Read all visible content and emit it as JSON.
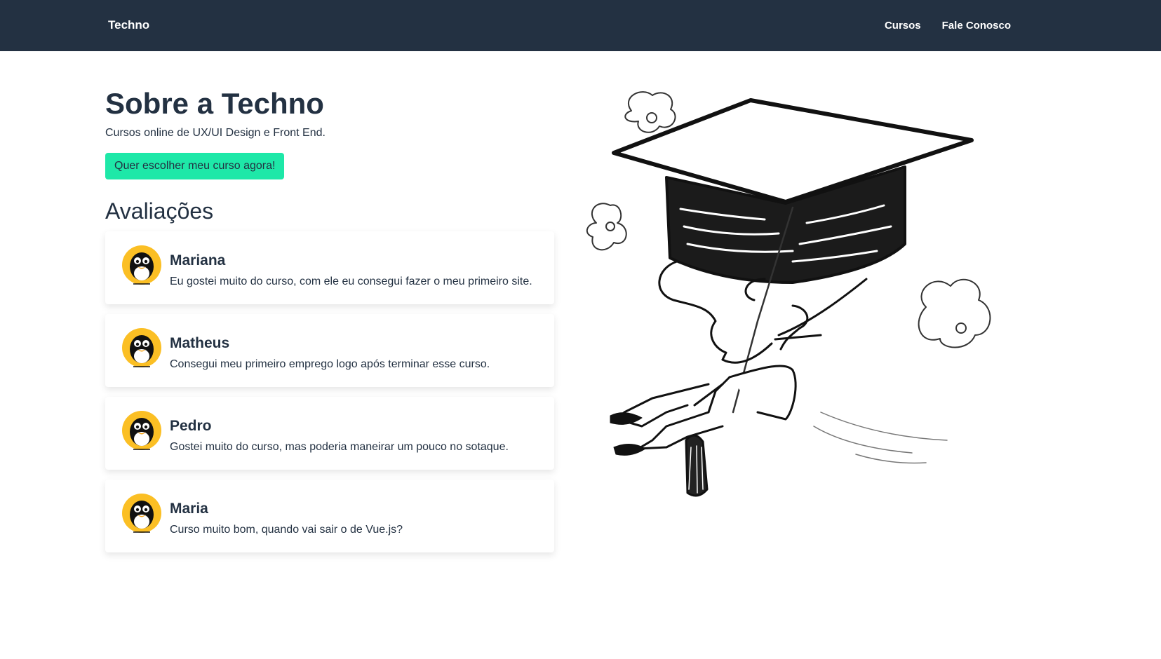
{
  "header": {
    "brand": "Techno",
    "nav": [
      "Cursos",
      "Fale Conosco"
    ]
  },
  "main": {
    "title": "Sobre a Techno",
    "subtitle": "Cursos online de UX/UI Design e Front End.",
    "cta_label": "Quer escolher meu curso agora!",
    "reviews_title": "Avaliações",
    "reviews": [
      {
        "name": "Mariana",
        "text": "Eu gostei muito do curso, com ele eu consegui fazer o meu primeiro site."
      },
      {
        "name": "Matheus",
        "text": "Consegui meu primeiro emprego logo após terminar esse curso."
      },
      {
        "name": "Pedro",
        "text": "Gostei muito do curso, mas poderia maneirar um pouco no sotaque."
      },
      {
        "name": "Maria",
        "text": "Curso muito bom, quando vai sair o de Vue.js?"
      }
    ]
  },
  "icons": {
    "avatar": "penguin-avatar-icon",
    "illustration": "graduation-cap-illustration"
  },
  "colors": {
    "header_bg": "#233142",
    "accent": "#1ee8a8",
    "text": "#233142",
    "avatar_bg": "#fbbf24"
  }
}
